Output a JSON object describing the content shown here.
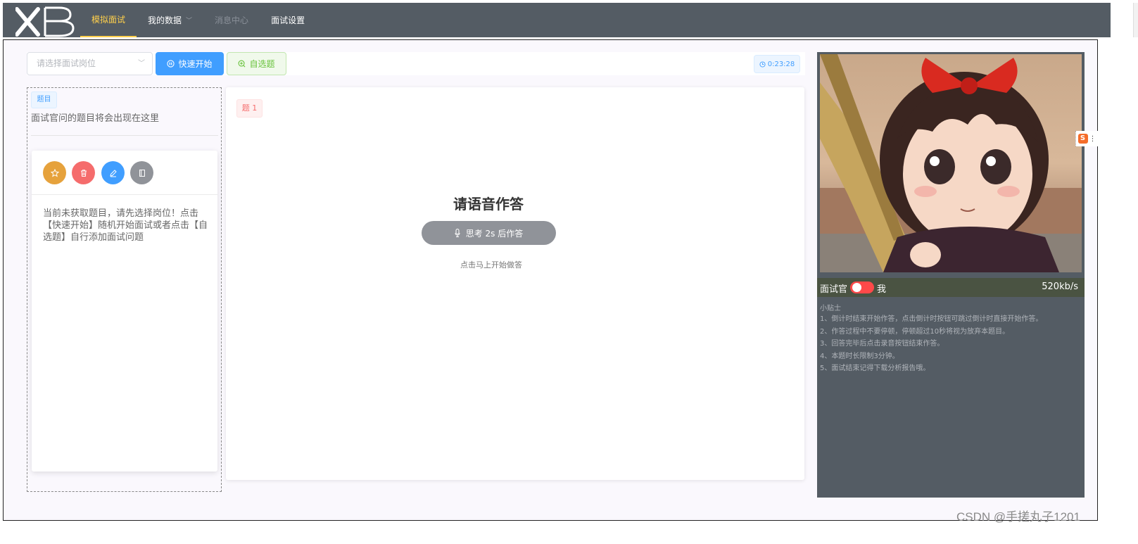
{
  "nav": {
    "logo_text": "xB",
    "items": [
      {
        "label": "模拟面试",
        "state": "active"
      },
      {
        "label": "我的数据",
        "state": "dropdown"
      },
      {
        "label": "消息中心",
        "state": "disabled"
      },
      {
        "label": "面试设置",
        "state": "normal"
      }
    ]
  },
  "toolbar": {
    "position_placeholder": "请选择面试岗位",
    "quick_start_label": "快速开始",
    "custom_question_label": "自选题",
    "timer": "0:23:28"
  },
  "left": {
    "tag": "题目",
    "question_placeholder": "面试官问的题目将会出现在这里",
    "card_text": "当前未获取题目，请先选择岗位！点击【快速开始】随机开始面试或者点击【自选题】自行添加面试问题"
  },
  "center": {
    "question_tag": "题 1",
    "title": "请语音作答",
    "think_button": "思考 2s 后作答",
    "hint": "点击马上开始做答"
  },
  "right": {
    "label_interviewer": "面试官",
    "label_me": "我",
    "toggle_on": true,
    "speed": "520kb/s",
    "tips_title": "小贴士",
    "tips": [
      "1、倒计时结束开始作答，点击倒计时按钮可跳过倒计时直接开始作答。",
      "2、作答过程中不要停顿，停顿超过10秒将视为放弃本题目。",
      "3、回答完毕后点击录音按钮结束作答。",
      "4、本题时长限制3分钟。",
      "5、面试结束记得下载分析报告哦。"
    ]
  },
  "watermark": "CSDN @手搓丸子1201",
  "colors": {
    "nav_bg": "#545c64",
    "nav_active": "#ffd04b",
    "primary": "#409eff",
    "success": "#67c23a",
    "danger": "#f56c6c",
    "warning": "#e6a23c",
    "info": "#909399"
  }
}
